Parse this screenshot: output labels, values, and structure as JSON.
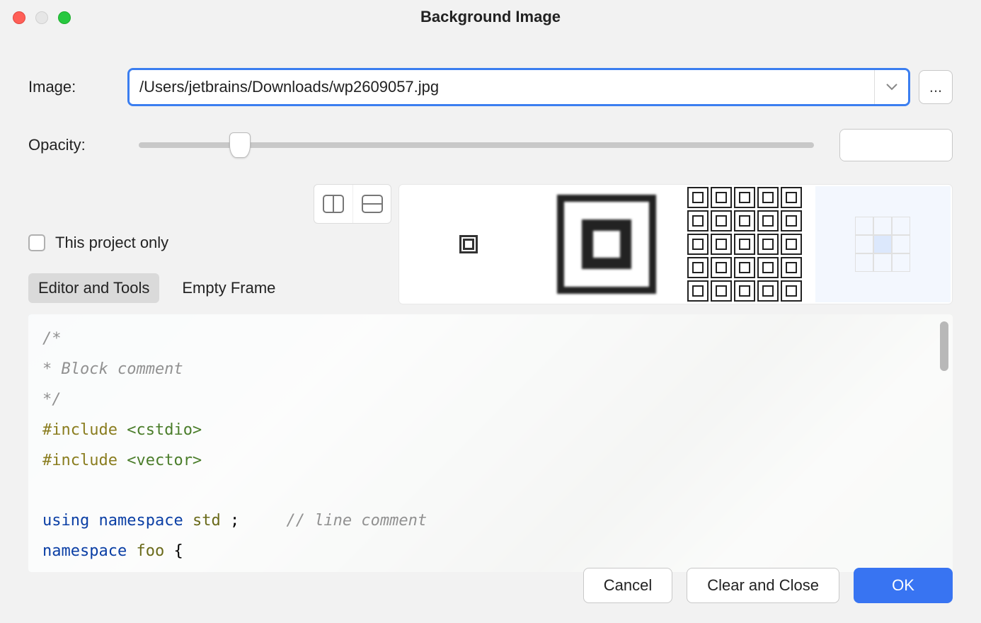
{
  "window": {
    "title": "Background Image"
  },
  "labels": {
    "image": "Image:",
    "opacity": "Opacity:",
    "project_only": "This project only"
  },
  "image_path": "/Users/jetbrains/Downloads/wp2609057.jpg",
  "opacity": {
    "value": "15",
    "percent": 15
  },
  "tabs": {
    "editor_tools": "Editor and Tools",
    "empty_frame": "Empty Frame"
  },
  "buttons": {
    "browse": "...",
    "cancel": "Cancel",
    "clear_close": "Clear and Close",
    "ok": "OK"
  },
  "preview_code": {
    "l1": "/*",
    "l2": " * Block comment",
    "l3": " */",
    "inc1_pp": "#include",
    "inc1_h": "<cstdio>",
    "inc2_pp": "#include",
    "inc2_h": "<vector>",
    "ln_using": "using",
    "ln_namespace": "namespace",
    "ln_std": "std",
    "ln_semi": ";",
    "ln_lcmt": "// line comment",
    "ln_ns2": "namespace",
    "ln_foo": "foo",
    "ln_brace": "{"
  }
}
